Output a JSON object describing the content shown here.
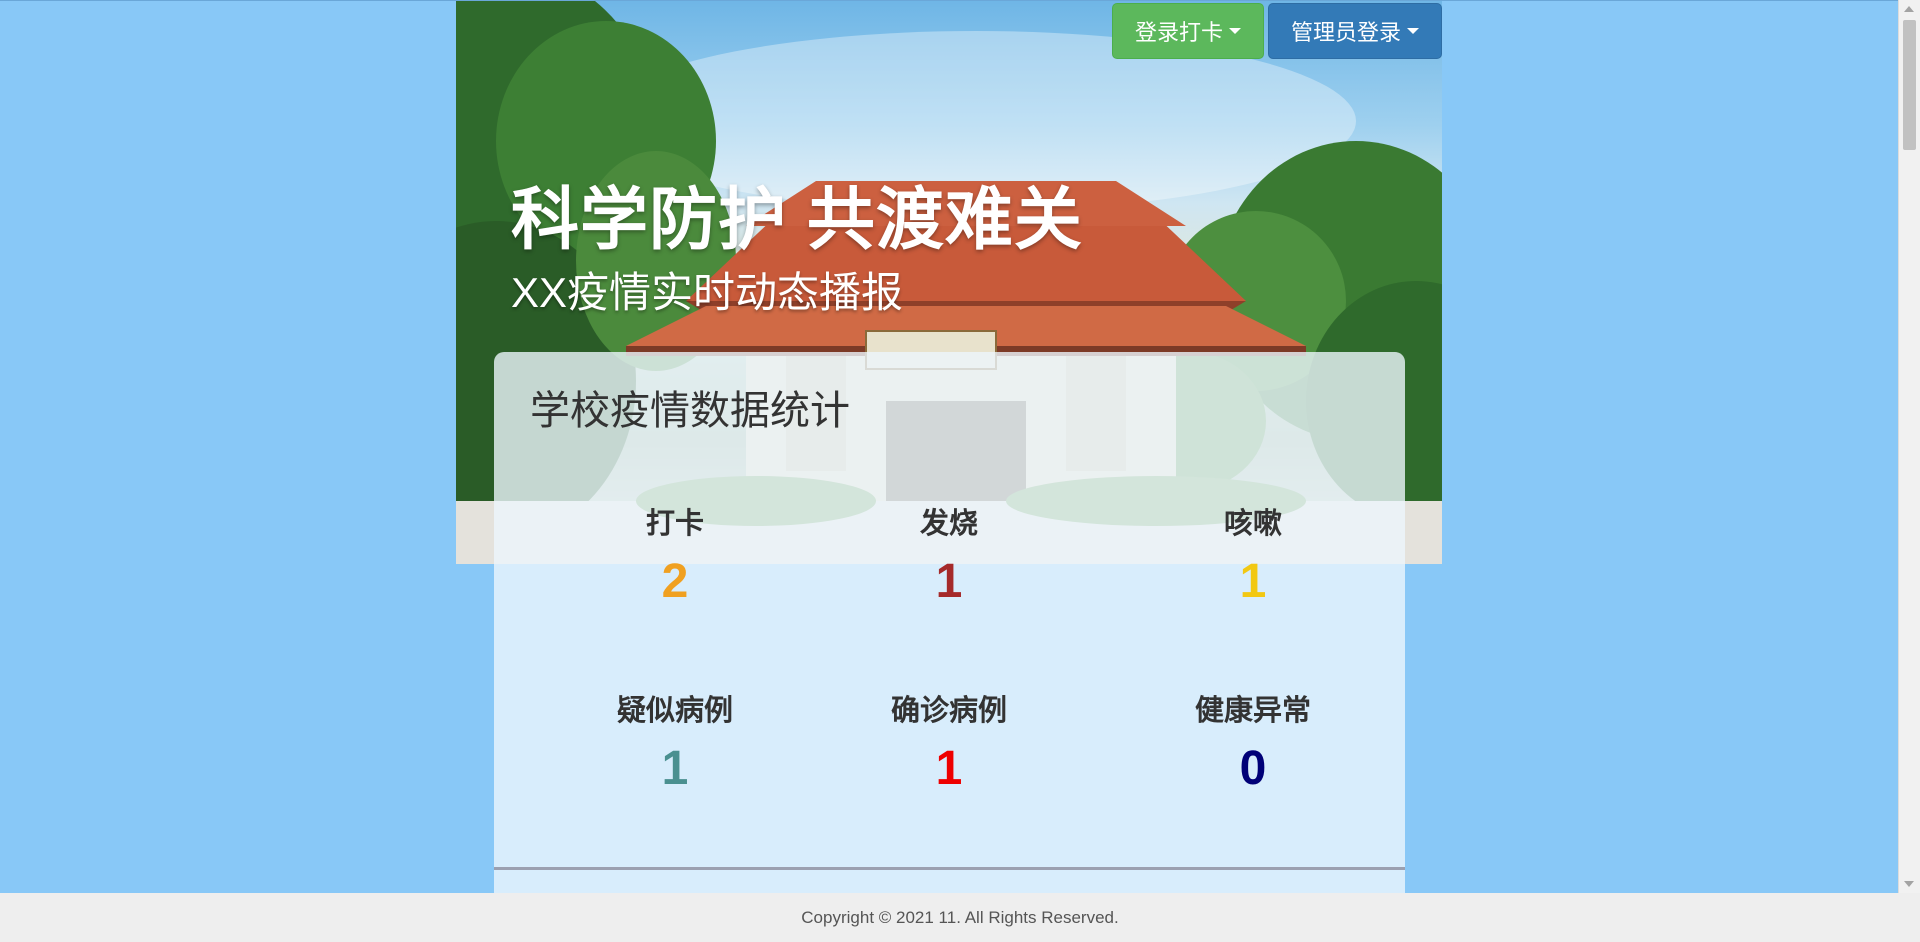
{
  "header": {
    "login_checkin": "登录打卡",
    "admin_login": "管理员登录"
  },
  "hero": {
    "title": "科学防护 共渡难关",
    "subtitle": "XX疫情实时动态播报"
  },
  "stats": {
    "title": "学校疫情数据统计",
    "items": [
      {
        "label": "打卡",
        "value": "2",
        "color": "#f0a020"
      },
      {
        "label": "发烧",
        "value": "1",
        "color": "#a52a2a"
      },
      {
        "label": "咳嗽",
        "value": "1",
        "color": "#f2c812"
      },
      {
        "label": "疑似病例",
        "value": "1",
        "color": "#4a9090"
      },
      {
        "label": "确诊病例",
        "value": "1",
        "color": "#ee0000"
      },
      {
        "label": "健康异常",
        "value": "0",
        "color": "#000077"
      }
    ]
  },
  "footer": {
    "copyright": "Copyright © 2021 11. All Rights Reserved."
  }
}
